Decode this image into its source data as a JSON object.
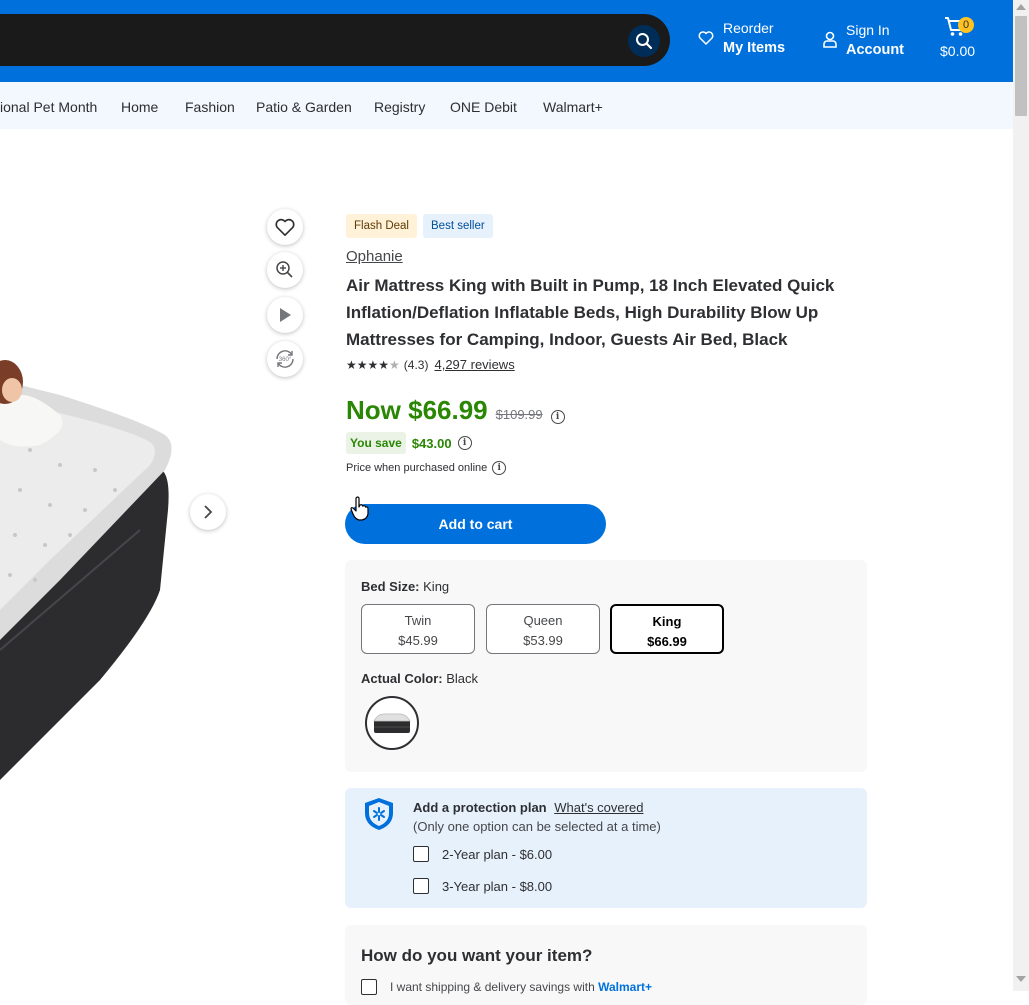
{
  "colors": {
    "brand_blue": "#0071dc",
    "price_green": "#2a8703",
    "spark_yellow": "#ffc220"
  },
  "header": {
    "reorder_line1": "Reorder",
    "reorder_line2": "My Items",
    "signin_line1": "Sign In",
    "signin_line2": "Account",
    "cart_count": "0",
    "cart_total": "$0.00"
  },
  "nav": {
    "items": [
      "ional Pet Month",
      "Home",
      "Fashion",
      "Patio & Garden",
      "Registry",
      "ONE Debit",
      "Walmart+"
    ]
  },
  "product": {
    "badges": {
      "flash": "Flash Deal",
      "best": "Best seller"
    },
    "brand": "Ophanie",
    "title": "Air Mattress King with Built in Pump, 18 Inch Elevated Quick Inflation/Deflation Inflatable Beds, High Durability Blow Up Mattresses for Camping, Indoor, Guests Air Bed, Black",
    "rating_text": "(4.3)",
    "rating_value": 4.3,
    "reviews": "4,297 reviews",
    "now_price": "Now $66.99",
    "was_price": "$109.99",
    "save_label": "You save",
    "save_amount": "$43.00",
    "online_note": "Price when purchased online",
    "add_to_cart": "Add to cart"
  },
  "variants": {
    "size_label": "Bed Size:",
    "size_value": "King",
    "sizes": [
      {
        "name": "Twin",
        "price": "$45.99"
      },
      {
        "name": "Queen",
        "price": "$53.99"
      },
      {
        "name": "King",
        "price": "$66.99"
      }
    ],
    "color_label": "Actual Color:",
    "color_value": "Black"
  },
  "protection": {
    "title": "Add a protection plan",
    "link": "What's covered",
    "note": "(Only one option can be selected at a time)",
    "plans": [
      "2-Year plan - $6.00",
      "3-Year plan - $8.00"
    ]
  },
  "delivery": {
    "title": "How do you want your item?",
    "option_text": "I want shipping & delivery savings with",
    "brand_text": "Walmart+"
  }
}
